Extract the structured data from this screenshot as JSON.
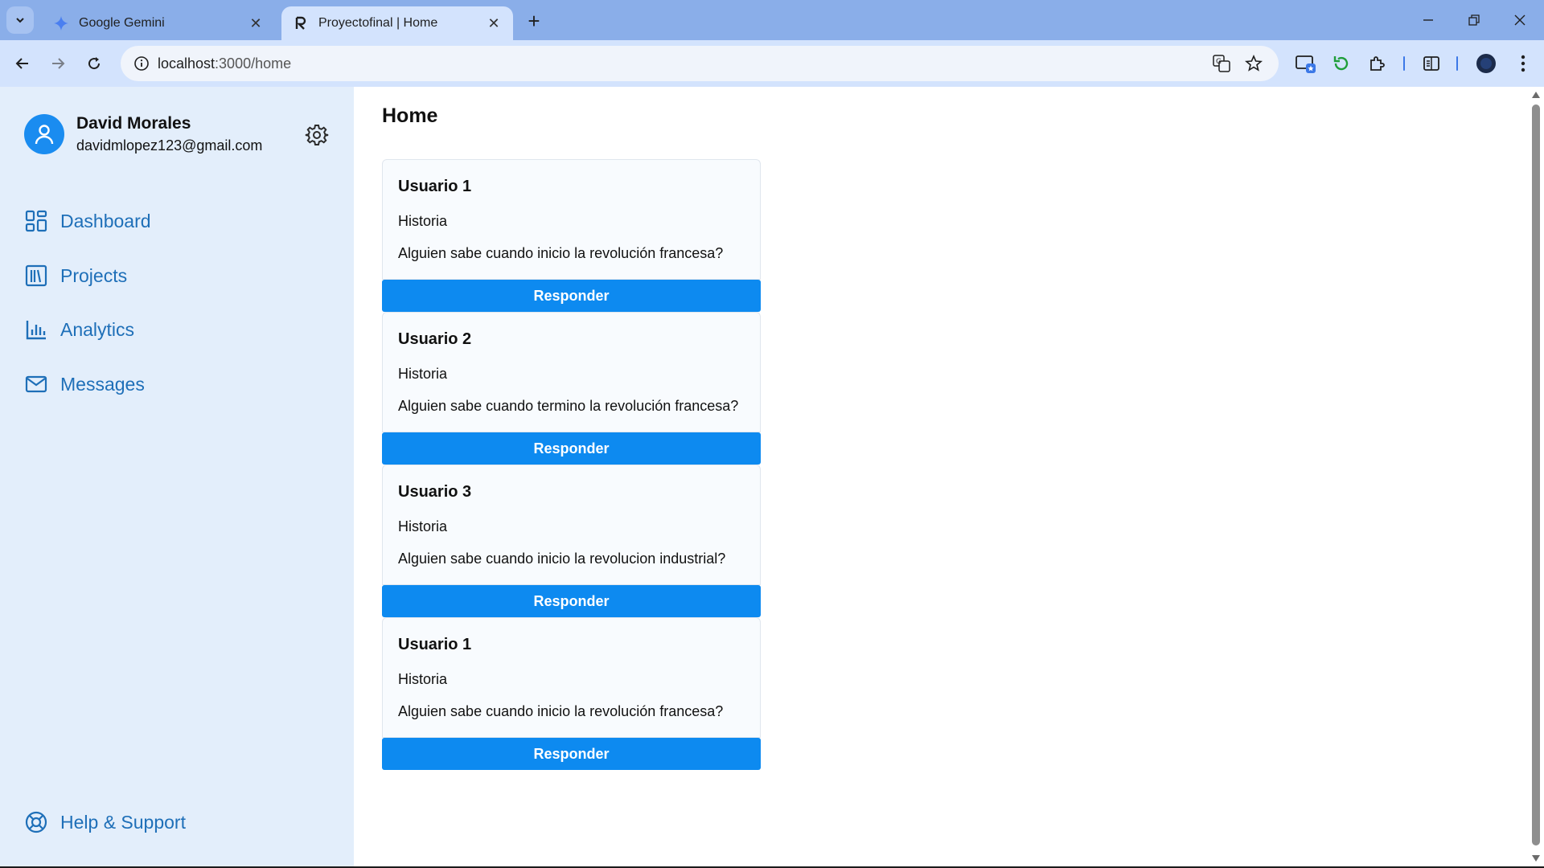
{
  "browser": {
    "tabs": [
      {
        "title": "Google Gemini",
        "favicon": "gemini-sparkle-icon",
        "active": false
      },
      {
        "title": "Proyectofinal | Home",
        "favicon": "letter-r-icon",
        "active": true
      }
    ],
    "new_tab": "+",
    "url_host": "localhost",
    "url_path": ":3000/home"
  },
  "sidebar": {
    "user": {
      "name": "David Morales",
      "email": "davidmlopez123@gmail.com"
    },
    "nav": [
      {
        "label": "Dashboard",
        "icon": "grid-icon"
      },
      {
        "label": "Projects",
        "icon": "library-icon"
      },
      {
        "label": "Analytics",
        "icon": "bar-chart-icon"
      },
      {
        "label": "Messages",
        "icon": "mail-icon"
      }
    ],
    "help": {
      "label": "Help & Support",
      "icon": "lifebuoy-icon"
    }
  },
  "main": {
    "title": "Home",
    "posts": [
      {
        "user": "Usuario 1",
        "subject": "Historia",
        "text": "Alguien sabe cuando inicio la revolución francesa?",
        "button": "Responder"
      },
      {
        "user": "Usuario 2",
        "subject": "Historia",
        "text": "Alguien sabe cuando termino la revolución francesa?",
        "button": "Responder"
      },
      {
        "user": "Usuario 3",
        "subject": "Historia",
        "text": "Alguien sabe cuando inicio la revolucion industrial?",
        "button": "Responder"
      },
      {
        "user": "Usuario 1",
        "subject": "Historia",
        "text": "Alguien sabe cuando inicio la revolución francesa?",
        "button": "Responder"
      }
    ]
  },
  "colors": {
    "accent": "#0d8af0",
    "sidebar_bg": "#e3eefb",
    "nav_text": "#1e6fb8",
    "tabbar_bg": "#8aaee9",
    "toolbar_bg": "#d3e3fd"
  }
}
